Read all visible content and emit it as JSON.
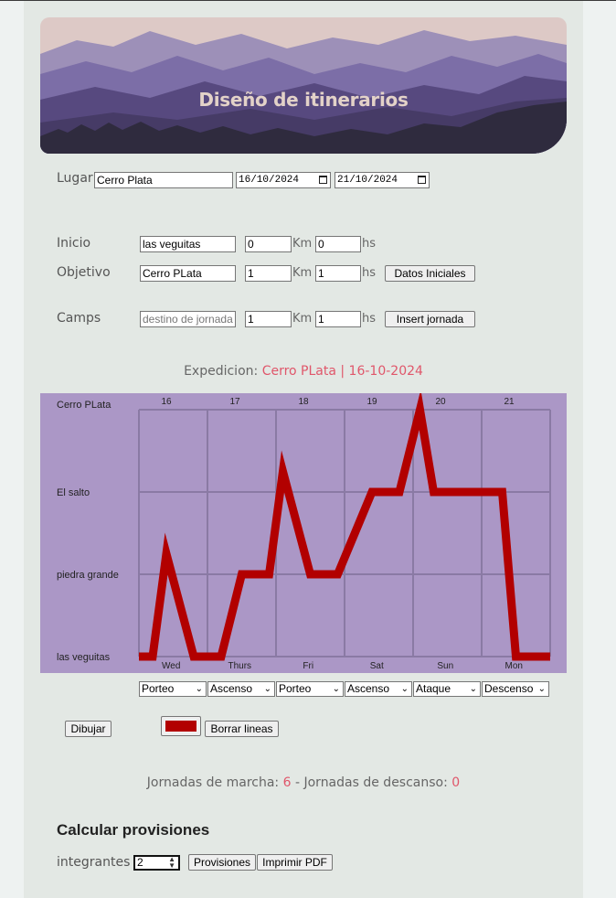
{
  "header": {
    "title": "Diseño de itinerarios",
    "colors": {
      "sky": "#ddc9c6",
      "far": "#9d90b8",
      "mid": "#7c6ea7",
      "near": "#57497f",
      "ground": "#2f2b3e"
    }
  },
  "form": {
    "lugar_label": "Lugar",
    "lugar_value": "Cerro Plata",
    "date_start": "16/10/2024",
    "date_end": "21/10/2024",
    "inicio": {
      "label": "Inicio",
      "place": "las veguitas",
      "km": "0",
      "hs": "0"
    },
    "objetivo": {
      "label": "Objetivo",
      "place": "Cerro PLata",
      "km": "1",
      "hs": "1"
    },
    "camps": {
      "label": "Camps",
      "placeholder": "destino de jornada",
      "km": "1",
      "hs": "1"
    },
    "km_unit": "Km",
    "hs_unit": "hs",
    "datos_button": "Datos Iniciales",
    "insert_button": "Insert jornada"
  },
  "expedition": {
    "prefix": "Expedicion: ",
    "value": "Cerro PLata | 16-10-2024"
  },
  "chart_data": {
    "type": "line",
    "background": "#ab97c6",
    "line_color": "#b20000",
    "y_categories": [
      "las veguitas",
      "piedra grande",
      "El salto",
      "Cerro PLata"
    ],
    "top_labels": [
      "16",
      "17",
      "18",
      "19",
      "20",
      "21"
    ],
    "bottom_labels": [
      "Wed",
      "Thurs",
      "Fri",
      "Sat",
      "Sun",
      "Mon"
    ],
    "x": [
      0,
      0.2,
      0.4,
      0.8,
      1.2,
      1.5,
      1.9,
      2.1,
      2.5,
      2.9,
      3.4,
      3.8,
      4.1,
      4.3,
      4.5,
      5.3,
      5.5,
      6
    ],
    "y": [
      0,
      0,
      1.25,
      0,
      0,
      1,
      1,
      2.25,
      1,
      1,
      2,
      2,
      3,
      2,
      2,
      2,
      0,
      0
    ],
    "grid": true
  },
  "selects": [
    "Porteo",
    "Ascenso",
    "Porteo",
    "Ascenso",
    "Ataque",
    "Descenso"
  ],
  "actions": {
    "draw_button": "Dibujar",
    "clear_button": "Borrar lineas",
    "line_color": "#b20000"
  },
  "summary": {
    "marcha_label": "Jornadas de marcha: ",
    "marcha_value": "6",
    "sep": " - ",
    "descanso_label": "Jornadas de descanso: ",
    "descanso_value": "0"
  },
  "provisions": {
    "title": "Calcular provisiones",
    "integrantes_label": "integrantes",
    "integrantes_value": "2",
    "provisiones_button": "Provisiones",
    "pdf_button": "Imprimir PDF"
  }
}
